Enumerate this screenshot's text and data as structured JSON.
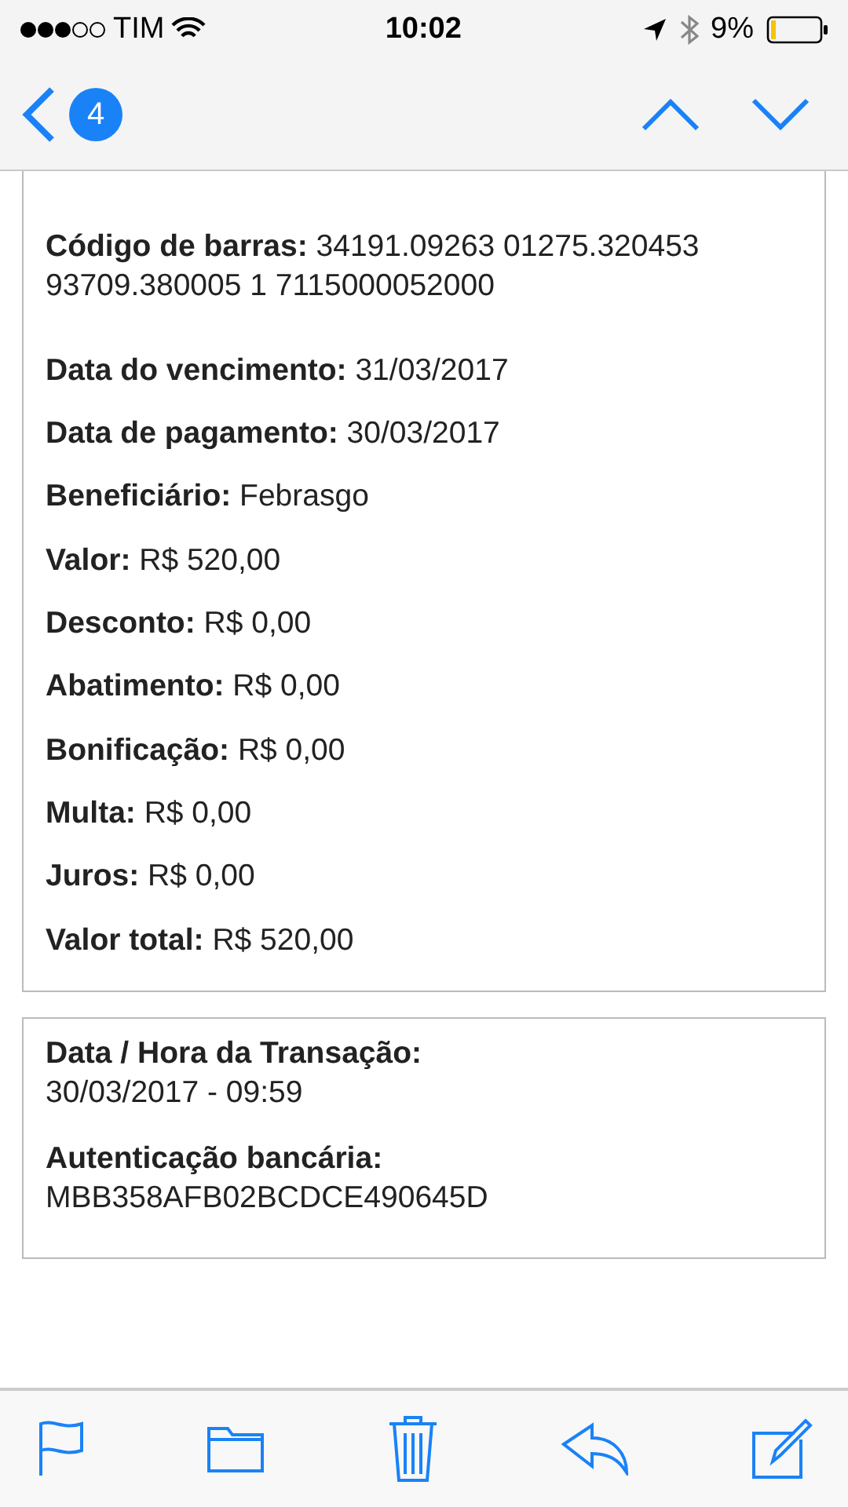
{
  "status_bar": {
    "carrier": "TIM",
    "time": "10:02",
    "battery": "9%"
  },
  "nav": {
    "badge": "4"
  },
  "receipt": {
    "barcode": "**Código de barras:** 34191.09263 01275.320453 93709.380005 1 7115000052000",
    "fields": [
      "**Data do vencimento:** 31/03/2017",
      "**Data de pagamento:** 30/03/2017",
      "**Beneficiário:** Febrasgo",
      "**Valor:** R$ 520,00",
      "**Desconto:** R$ 0,00",
      "**Abatimento:** R$ 0,00",
      "**Bonificação:** R$ 0,00",
      "**Multa:** R$ 0,00",
      "**Juros:** R$ 0,00",
      "**Valor total:** R$ 520,00"
    ]
  },
  "transaction": {
    "items": [
      {
        "label": "Data / Hora da Transação:",
        "value": "30/03/2017 - 09:59"
      },
      {
        "label": "Autenticação bancária:",
        "value": "MBB358AFB02BCDCE490645D"
      }
    ]
  }
}
